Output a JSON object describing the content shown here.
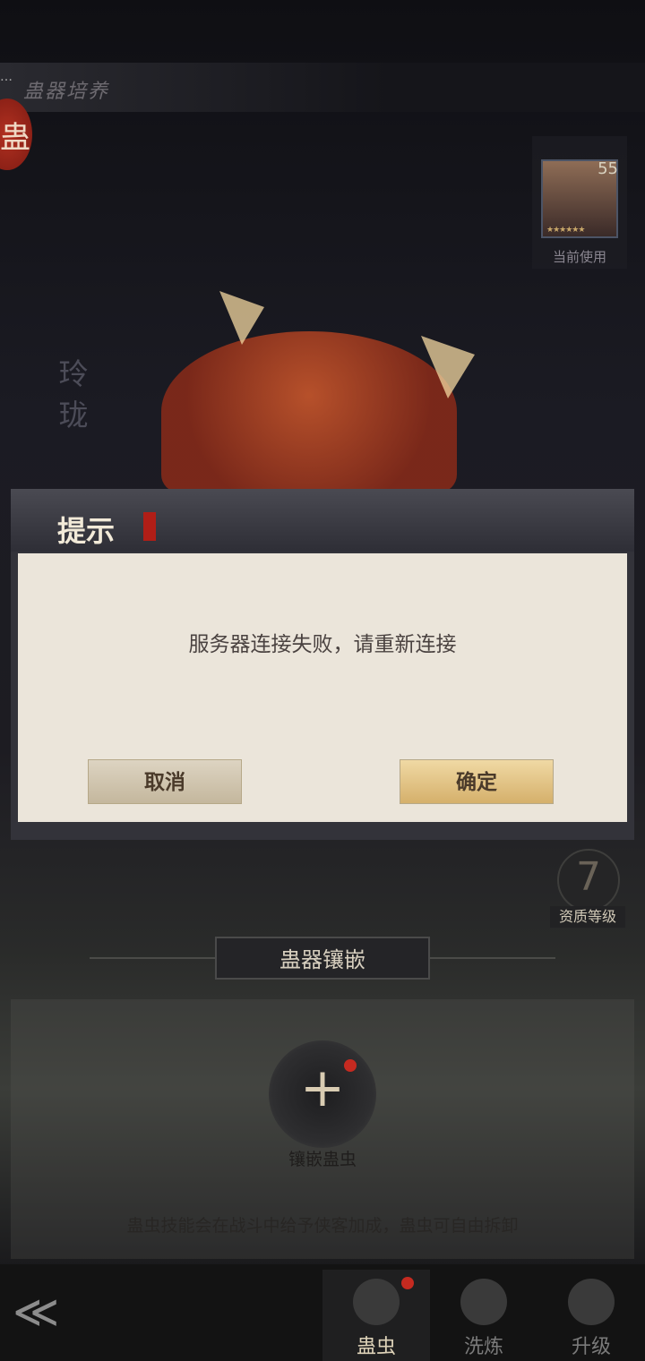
{
  "page": {
    "title": "蛊器培养",
    "seal_char": "蛊"
  },
  "character": {
    "level": "55",
    "stars": "★★★★★★",
    "label": "当前使用"
  },
  "item_name": "玲珑",
  "dialog": {
    "title": "提示",
    "message": "服务器连接失败，请重新连接",
    "cancel": "取消",
    "confirm": "确定"
  },
  "grade": {
    "value": "7",
    "label": "资质等级"
  },
  "inlay": {
    "section_title": "蛊器镶嵌",
    "plus_symbol": "+",
    "add_label": "镶嵌蛊虫",
    "note": "蛊虫技能会在战斗中给予侠客加成，蛊虫可自由拆卸"
  },
  "tabs": [
    {
      "label": "蛊虫",
      "icon": "bug-icon"
    },
    {
      "label": "洗炼",
      "icon": "refine-icon"
    },
    {
      "label": "升级",
      "icon": "upgrade-icon"
    }
  ],
  "back_symbol": "≪"
}
